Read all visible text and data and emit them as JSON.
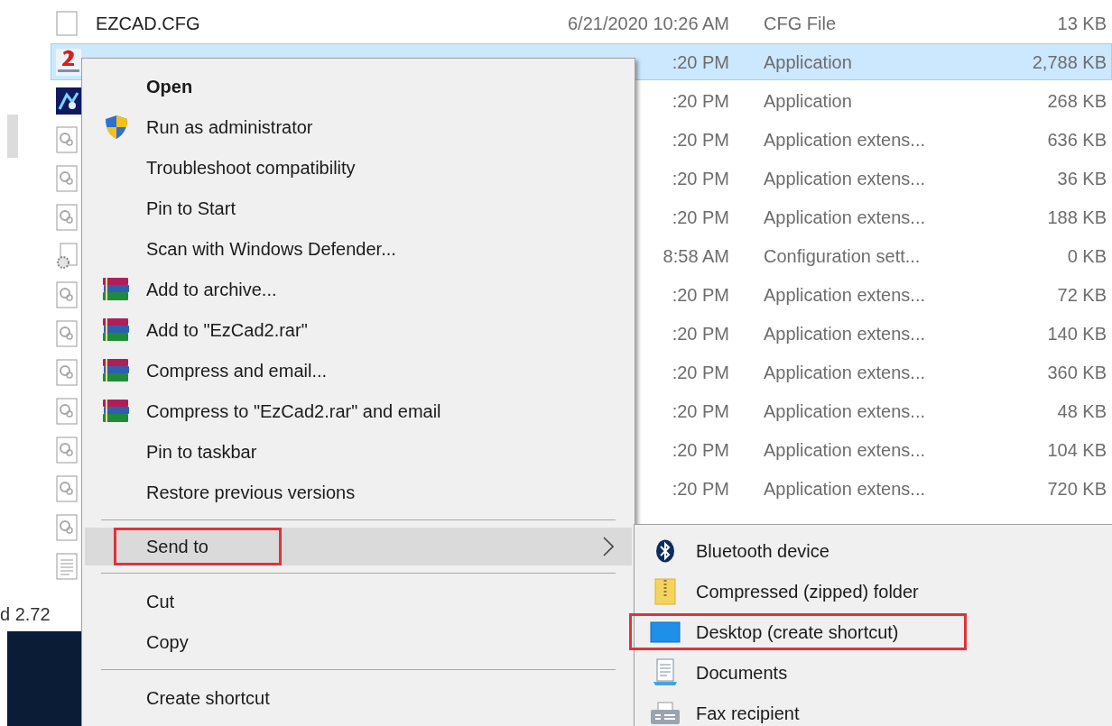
{
  "file_list": {
    "rows": [
      {
        "kind": "blank",
        "name": "EZCAD.CFG",
        "modified": "6/21/2020 10:26 AM",
        "type": "CFG File",
        "size": "13 KB",
        "selected": false
      },
      {
        "kind": "ezcad",
        "modified": ":20 PM",
        "type": "Application",
        "size": "2,788 KB",
        "selected": true
      },
      {
        "kind": "app",
        "modified": ":20 PM",
        "type": "Application",
        "size": "268 KB",
        "selected": false
      },
      {
        "kind": "dll",
        "modified": ":20 PM",
        "type": "Application extens...",
        "size": "636 KB",
        "selected": false
      },
      {
        "kind": "dll",
        "modified": ":20 PM",
        "type": "Application extens...",
        "size": "36 KB",
        "selected": false
      },
      {
        "kind": "dll",
        "modified": ":20 PM",
        "type": "Application extens...",
        "size": "188 KB",
        "selected": false
      },
      {
        "kind": "config",
        "modified": "8:58 AM",
        "type": "Configuration sett...",
        "size": "0 KB",
        "selected": false
      },
      {
        "kind": "dll",
        "modified": ":20 PM",
        "type": "Application extens...",
        "size": "72 KB",
        "selected": false
      },
      {
        "kind": "dll",
        "modified": ":20 PM",
        "type": "Application extens...",
        "size": "140 KB",
        "selected": false
      },
      {
        "kind": "dll",
        "modified": ":20 PM",
        "type": "Application extens...",
        "size": "360 KB",
        "selected": false
      },
      {
        "kind": "dll",
        "modified": ":20 PM",
        "type": "Application extens...",
        "size": "48 KB",
        "selected": false
      },
      {
        "kind": "dll",
        "modified": ":20 PM",
        "type": "Application extens...",
        "size": "104 KB",
        "selected": false
      },
      {
        "kind": "dll",
        "modified": ":20 PM",
        "type": "Application extens...",
        "size": "720 KB",
        "selected": false
      },
      {
        "kind": "dll",
        "selected": false
      },
      {
        "kind": "text",
        "selected": false
      }
    ]
  },
  "status_bar": {
    "text": "d 2.72"
  },
  "context_menu": {
    "items": [
      {
        "kind": "item",
        "label": "Open",
        "bold": true
      },
      {
        "kind": "shield",
        "label": "Run as administrator"
      },
      {
        "kind": "item",
        "label": "Troubleshoot compatibility"
      },
      {
        "kind": "item",
        "label": "Pin to Start"
      },
      {
        "kind": "item",
        "label": "Scan with Windows Defender..."
      },
      {
        "kind": "archive",
        "label": "Add to archive..."
      },
      {
        "kind": "archive",
        "label": "Add to \"EzCad2.rar\""
      },
      {
        "kind": "archive",
        "label": "Compress and email..."
      },
      {
        "kind": "archive",
        "label": "Compress to \"EzCad2.rar\" and email"
      },
      {
        "kind": "item",
        "label": "Pin to taskbar"
      },
      {
        "kind": "item",
        "label": "Restore previous versions"
      },
      {
        "kind": "separator"
      },
      {
        "kind": "submenu",
        "label": "Send to",
        "highlighted": true,
        "outlined": true
      },
      {
        "kind": "separator"
      },
      {
        "kind": "item",
        "label": "Cut"
      },
      {
        "kind": "item",
        "label": "Copy"
      },
      {
        "kind": "separator"
      },
      {
        "kind": "item",
        "label": "Create shortcut"
      }
    ]
  },
  "send_to_menu": {
    "items": [
      {
        "kind": "bluetooth",
        "label": "Bluetooth device",
        "outlined": false
      },
      {
        "kind": "zip",
        "label": "Compressed (zipped) folder",
        "outlined": false
      },
      {
        "kind": "desktop",
        "label": "Desktop (create shortcut)",
        "outlined": true
      },
      {
        "kind": "documents",
        "label": "Documents",
        "outlined": false
      },
      {
        "kind": "fax",
        "label": "Fax recipient",
        "outlined": false
      }
    ]
  }
}
